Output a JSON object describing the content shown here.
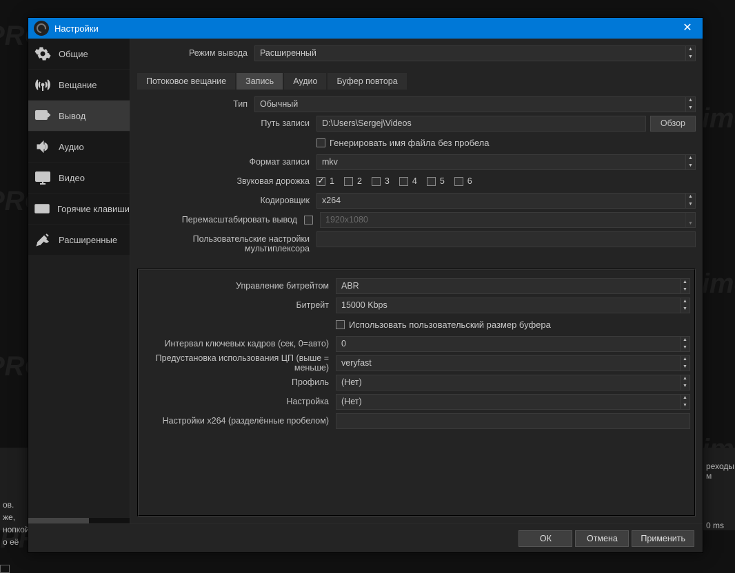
{
  "window": {
    "title": "Настройки"
  },
  "sidebar": {
    "items": [
      {
        "label": "Общие"
      },
      {
        "label": "Вещание"
      },
      {
        "label": "Вывод"
      },
      {
        "label": "Аудио"
      },
      {
        "label": "Видео"
      },
      {
        "label": "Горячие клавиши"
      },
      {
        "label": "Расширенные"
      }
    ],
    "active_index": 2
  },
  "output_mode": {
    "label": "Режим вывода",
    "value": "Расширенный"
  },
  "tabs": {
    "items": [
      "Потоковое вещание",
      "Запись",
      "Аудио",
      "Буфер повтора"
    ],
    "active_index": 1
  },
  "rec": {
    "type_label": "Тип",
    "type_value": "Обычный",
    "path_label": "Путь записи",
    "path_value": "D:\\Users\\Sergej\\Videos",
    "browse": "Обзор",
    "nospace_label": "Генерировать имя файла без пробела",
    "nospace_checked": false,
    "format_label": "Формат записи",
    "format_value": "mkv",
    "track_label": "Звуковая дорожка",
    "tracks": [
      "1",
      "2",
      "3",
      "4",
      "5",
      "6"
    ],
    "tracks_checked": [
      true,
      false,
      false,
      false,
      false,
      false
    ],
    "encoder_label": "Кодировщик",
    "encoder_value": "x264",
    "rescale_label": "Перемасштабировать вывод",
    "rescale_checked": false,
    "rescale_value": "1920x1080",
    "mux_label": "Пользовательские настройки мультиплексора",
    "mux_value": ""
  },
  "enc": {
    "rate_label": "Управление битрейтом",
    "rate_value": "ABR",
    "bitrate_label": "Битрейт",
    "bitrate_value": "15000 Kbps",
    "custbuf_label": "Использовать пользовательский размер буфера",
    "custbuf_checked": false,
    "keyint_label": "Интервал ключевых кадров (сек, 0=авто)",
    "keyint_value": "0",
    "cpu_label": "Предустановка использования ЦП (выше = меньше)",
    "cpu_value": "veryfast",
    "profile_label": "Профиль",
    "profile_value": "(Нет)",
    "tune_label": "Настройка",
    "tune_value": "(Нет)",
    "x264_label": "Настройки x264 (разделённые пробелом)",
    "x264_value": ""
  },
  "footer": {
    "ok": "ОК",
    "cancel": "Отмена",
    "apply": "Применить"
  },
  "background": {
    "snippet1": "ов.",
    "snippet2": "же,",
    "snippet3": "нопкой",
    "snippet4": "о её",
    "snippet5": "реходы м",
    "snippet6": "0 ms",
    "watermark": "PROstrimer.ru"
  }
}
